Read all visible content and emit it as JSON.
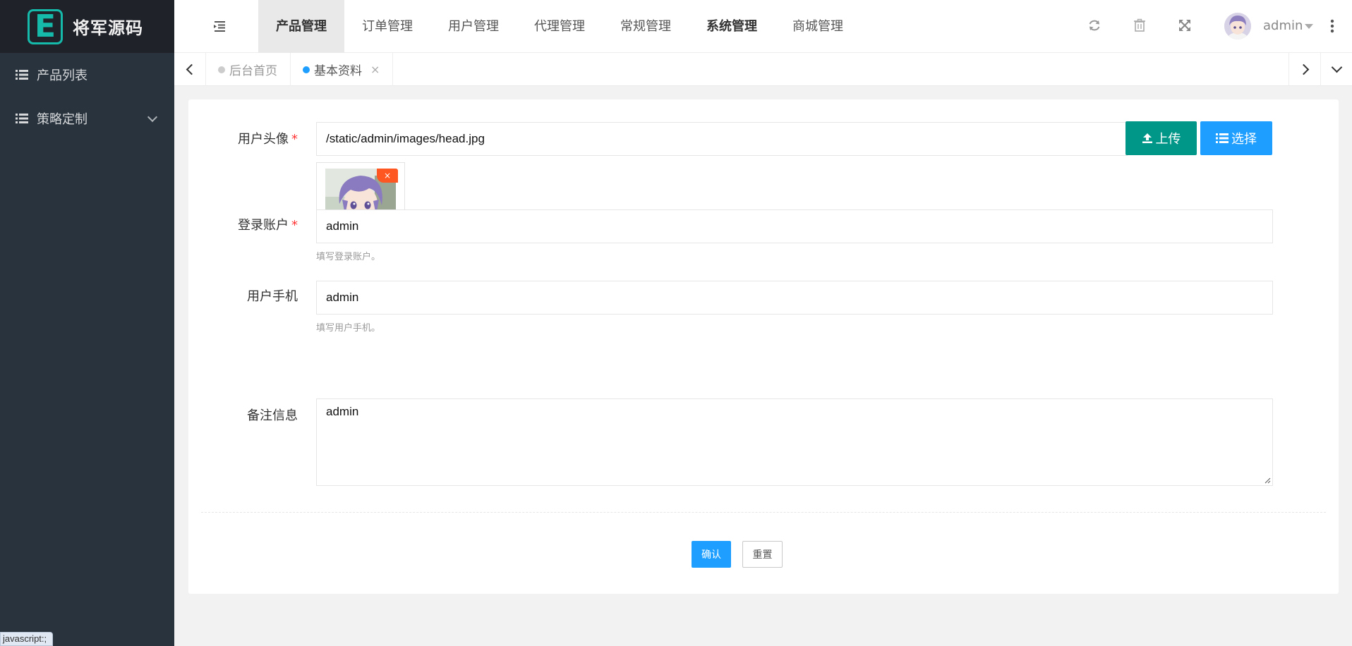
{
  "app": {
    "logo_letter": "E",
    "logo_text": "将军源码"
  },
  "sidebar": {
    "items": [
      {
        "label": "产品列表",
        "icon": "list-icon"
      },
      {
        "label": "策略定制",
        "icon": "list-icon",
        "expandable": true
      }
    ]
  },
  "header": {
    "nav": [
      {
        "label": "产品管理",
        "active": true
      },
      {
        "label": "订单管理"
      },
      {
        "label": "用户管理"
      },
      {
        "label": "代理管理"
      },
      {
        "label": "常规管理"
      },
      {
        "label": "系统管理"
      },
      {
        "label": "商城管理"
      }
    ],
    "icons": [
      "refresh-icon",
      "trash-icon",
      "fullscreen-icon",
      "more-icon"
    ],
    "user": {
      "name": "admin"
    }
  },
  "tabs": [
    {
      "label": "后台首页",
      "active": false
    },
    {
      "label": "基本资料",
      "active": true,
      "close": "×"
    }
  ],
  "form": {
    "avatar": {
      "label": "用户头像",
      "required": "*",
      "value": "/static/admin/images/head.jpg",
      "upload_label": "上传",
      "select_label": "选择",
      "remove": "×"
    },
    "account": {
      "label": "登录账户",
      "required": "*",
      "value": "admin",
      "hint": "填写登录账户。"
    },
    "phone": {
      "label": "用户手机",
      "value": "admin",
      "hint": "填写用户手机。"
    },
    "remark": {
      "label": "备注信息",
      "value": "admin"
    },
    "confirm_label": "确认",
    "reset_label": "重置"
  },
  "status_bar": "javascript:;",
  "colors": {
    "sidebar": "#28333e",
    "logo_bg": "#20222a",
    "accent_green": "#009688",
    "accent_blue": "#1e9fff",
    "danger": "#ff5722",
    "logo_teal": "#16baaa"
  }
}
